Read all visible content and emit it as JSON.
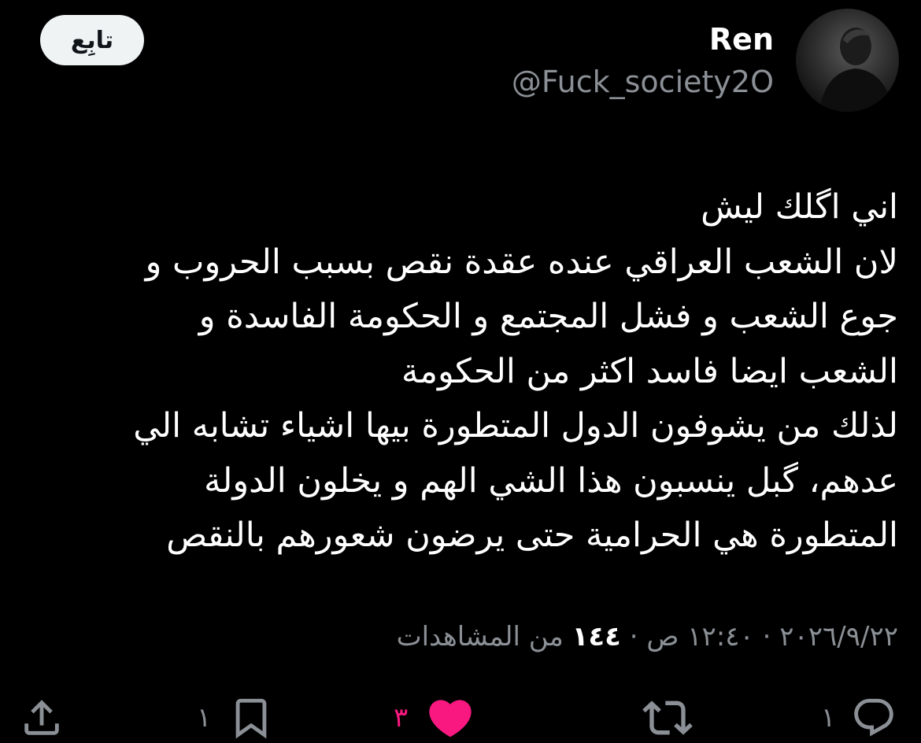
{
  "author": {
    "name": "Ren",
    "handle": "@Fuck_society2O"
  },
  "follow_label": "تابِع",
  "tweet": {
    "lines": [
      "اني اگلك ليش",
      "لان الشعب العراقي عنده عقدة نقص بسبب الحروب و",
      "جوع الشعب و فشل المجتمع و الحكومة الفاسدة و",
      "الشعب ايضا فاسد اكثر من الحكومة",
      "لذلك من يشوفون الدول المتطورة بيها اشياء تشابه الي",
      "عدهم، گبل ينسبون هذا الشي الهم و يخلون الدولة",
      "المتطورة هي الحرامية حتى يرضون شعورهم بالنقص"
    ]
  },
  "meta": {
    "date": "٢٠٢٦/٩/٢٢",
    "separator": " · ",
    "time": "١٢:٤٠ ص",
    "views_count": "١٤٤",
    "views_label": " من المشاهدات"
  },
  "actions": {
    "replies": "١",
    "likes": "٣",
    "bookmarks": "١"
  },
  "colors": {
    "background": "#000000",
    "text": "#ffffff",
    "secondary": "#8b9096",
    "like": "#f91880",
    "follow_bg": "#eff3f4"
  },
  "icons": {
    "reply": "reply-icon",
    "retweet": "retweet-icon",
    "like": "heart-icon",
    "bookmark": "bookmark-icon",
    "share": "share-icon"
  }
}
